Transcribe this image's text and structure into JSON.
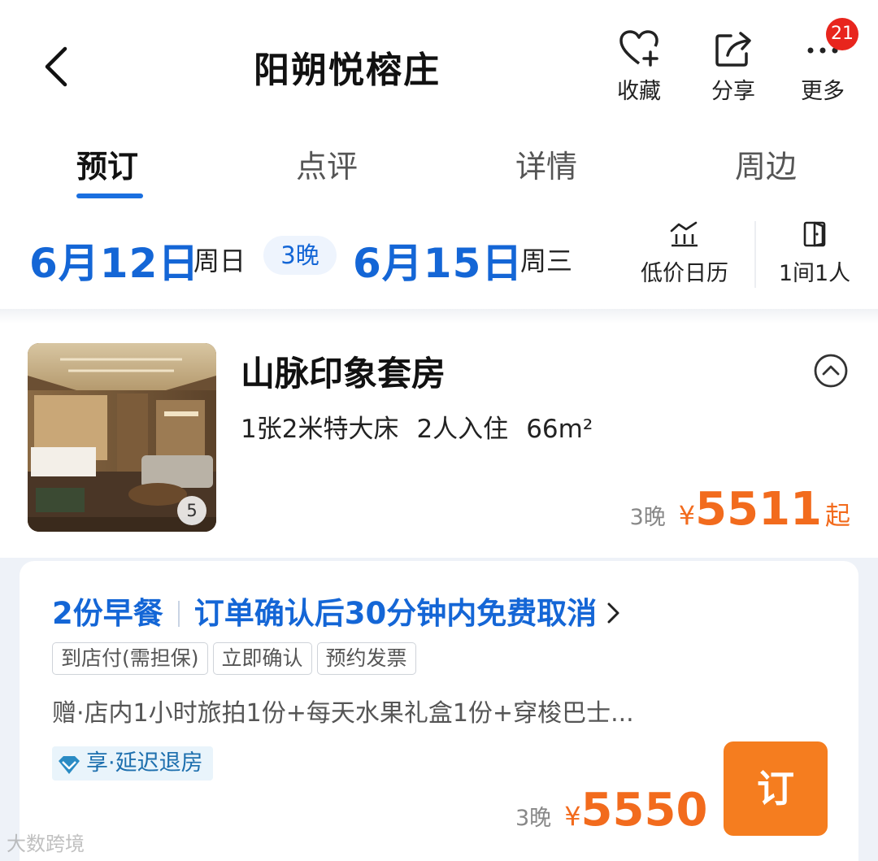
{
  "header": {
    "title": "阳朔悦榕庄",
    "actions": [
      {
        "label": "收藏",
        "icon": "heart-plus-icon"
      },
      {
        "label": "分享",
        "icon": "share-icon"
      },
      {
        "label": "更多",
        "icon": "more-dots-icon"
      }
    ],
    "more_badge": "21"
  },
  "tabs": [
    {
      "label": "预订",
      "active": true
    },
    {
      "label": "点评",
      "active": false
    },
    {
      "label": "详情",
      "active": false
    },
    {
      "label": "周边",
      "active": false
    }
  ],
  "stay": {
    "checkin_date": "6月12日",
    "checkin_weekday": "周日",
    "nights": "3晚",
    "checkout_date": "6月15日",
    "checkout_weekday": "周三",
    "calendar_label": "低价日历",
    "guests_label": "1间1人"
  },
  "room": {
    "name": "山脉印象套房",
    "bed": "1张2米特大床",
    "occupancy": "2人入住",
    "area": "66m²",
    "photo_count": "5",
    "nights": "3晚",
    "currency": "¥",
    "price": "5511",
    "price_suffix": "起"
  },
  "rate": {
    "breakfast": "2份早餐",
    "cancel_policy": "订单确认后30分钟内免费取消",
    "tags": [
      "到店付(需担保)",
      "立即确认",
      "预约发票"
    ],
    "gift": "赠·店内1小时旅拍1份+每天水果礼盒1份+穿梭巴士...",
    "perk": "享·延迟退房",
    "nights": "3晚",
    "currency": "¥",
    "price": "5550",
    "book_label": "订"
  },
  "watermark": "大数跨境",
  "colors": {
    "accent_blue": "#1466d6",
    "price_orange": "#f26b1d",
    "book_button": "#f57d1f",
    "badge_red": "#e8251d"
  }
}
